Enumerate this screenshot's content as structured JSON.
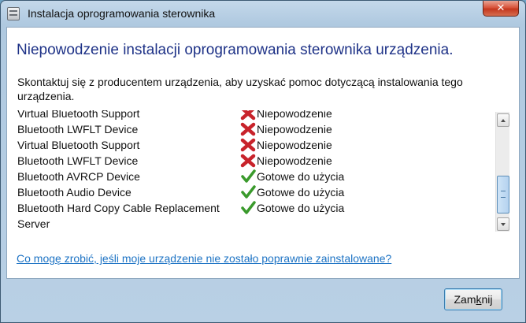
{
  "window": {
    "title": "Instalacja oprogramowania sterownika",
    "close_glyph": "✕"
  },
  "heading": "Niepowodzenie instalacji oprogramowania sterownika urządzenia.",
  "instruction": "Skontaktuj się z producentem urządzenia, aby uzyskać pomoc dotyczącą instalowania tego urządzenia.",
  "devices": [
    {
      "name": "Virtual Bluetooth Support",
      "status": "Niepowodzenie",
      "icon": "error-x-icon"
    },
    {
      "name": "Bluetooth LWFLT Device",
      "status": "Niepowodzenie",
      "icon": "error-x-icon"
    },
    {
      "name": "Virtual Bluetooth Support",
      "status": "Niepowodzenie",
      "icon": "error-x-icon"
    },
    {
      "name": "Bluetooth LWFLT Device",
      "status": "Niepowodzenie",
      "icon": "error-x-icon"
    },
    {
      "name": "Bluetooth AVRCP Device",
      "status": "Gotowe do użycia",
      "icon": "checkmark-icon"
    },
    {
      "name": "Bluetooth Audio Device",
      "status": "Gotowe do użycia",
      "icon": "checkmark-icon"
    },
    {
      "name": "Bluetooth Hard Copy Cable Replacement",
      "status": "Gotowe do użycia",
      "icon": "checkmark-icon"
    },
    {
      "name": "Server",
      "status": "",
      "icon": ""
    }
  ],
  "help_link": "Co mogę zrobić, jeśli moje urządzenie nie zostało poprawnie zainstalowane?",
  "close_button": {
    "label_before": "Zam",
    "label_accel": "k",
    "label_after": "nij"
  },
  "colors": {
    "heading": "#1e3287",
    "link": "#1d73c4",
    "error": "#c8232b",
    "success": "#3a9a2c"
  }
}
